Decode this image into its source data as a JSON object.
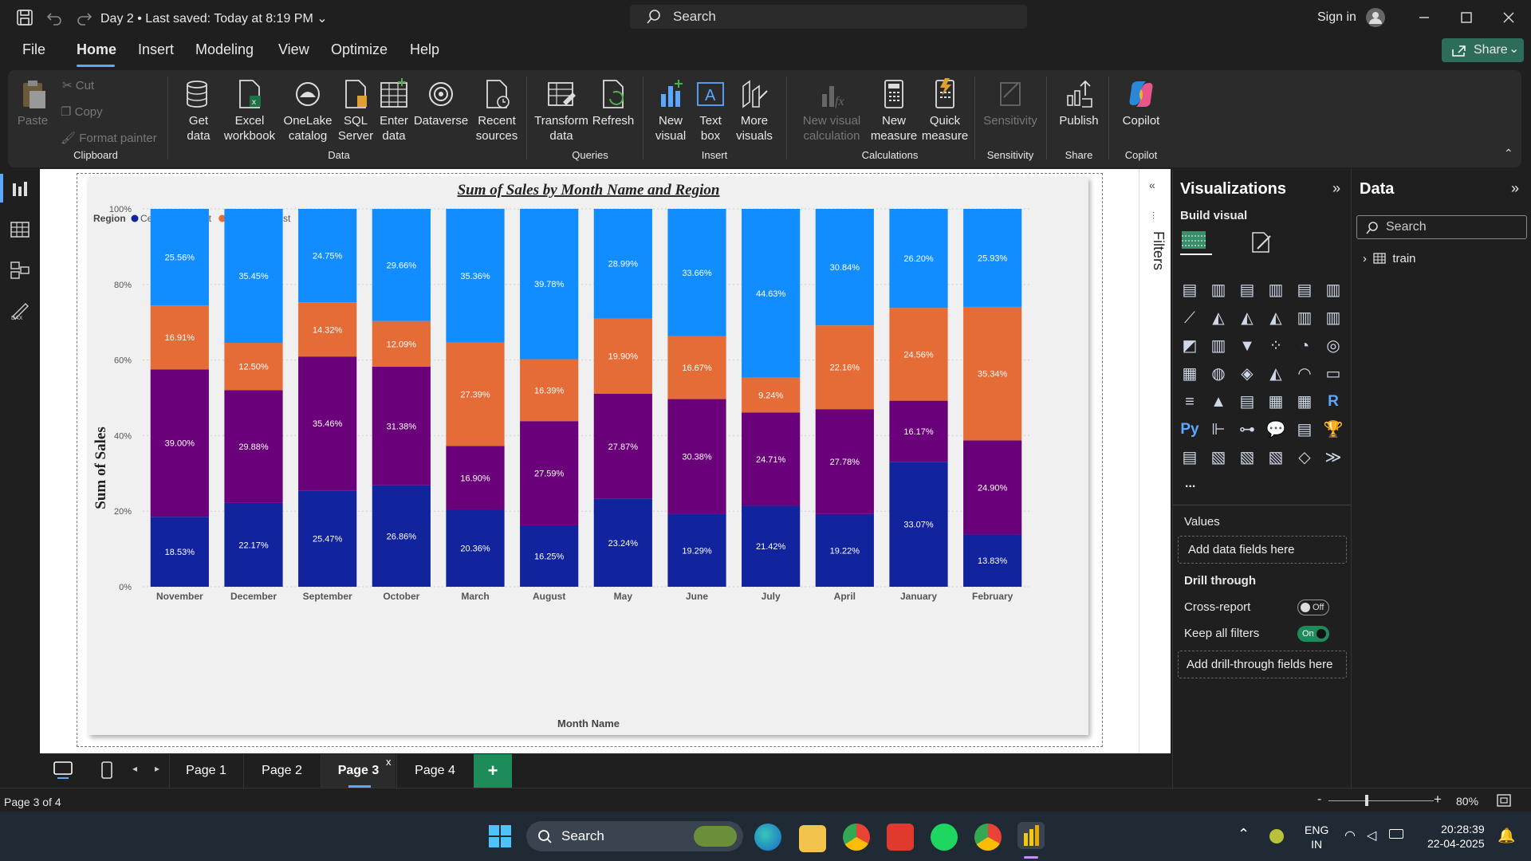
{
  "app": {
    "file_name": "Day 2",
    "saved": "Last saved: Today at 8:19 PM",
    "search": "Search",
    "signin": "Sign in"
  },
  "menus": [
    "File",
    "Home",
    "Insert",
    "Modeling",
    "View",
    "Optimize",
    "Help"
  ],
  "share": "Share",
  "ribbon": {
    "paste": "Paste",
    "cut": "Cut",
    "copy": "Copy",
    "format_painter": "Format painter",
    "clipboard": "Clipboard",
    "get_data": "Get data",
    "excel": "Excel workbook",
    "onelake": "OneLake catalog",
    "sql": "SQL Server",
    "enter": "Enter data",
    "dataverse": "Dataverse",
    "recent": "Recent sources",
    "data": "Data",
    "transform": "Transform data",
    "refresh": "Refresh",
    "queries": "Queries",
    "new_visual": "New visual",
    "text_box": "Text box",
    "more_visuals": "More visuals",
    "insert": "Insert",
    "new_visual_calc": "New visual calculation",
    "new_measure": "New measure",
    "quick_measure": "Quick measure",
    "calculations": "Calculations",
    "sensitivity": "Sensitivity",
    "sensitivity_group": "Sensitivity",
    "publish": "Publish",
    "share_group": "Share",
    "copilot": "Copilot",
    "copilot_group": "Copilot"
  },
  "pages": [
    "Page 1",
    "Page 2",
    "Page 3",
    "Page 4"
  ],
  "active_page": "Page 3",
  "status": {
    "page": "Page 3 of 4",
    "zoom": "80%"
  },
  "filters": "Filters",
  "viz": {
    "title": "Visualizations",
    "build": "Build visual",
    "values": "Values",
    "add_fields": "Add data fields here",
    "drill": "Drill through",
    "cross": "Cross-report",
    "keep": "Keep all filters",
    "off": "Off",
    "on": "On",
    "add_drill": "Add drill-through fields here",
    "more": "..."
  },
  "data_pane": {
    "title": "Data",
    "search": "Search",
    "table": "train"
  },
  "taskbar": {
    "search": "Search",
    "lang": "ENG",
    "region": "IN",
    "time": "20:28:39",
    "date": "22-04-2025"
  },
  "colors": {
    "Central": "#12239e",
    "East": "#6b007b",
    "South": "#e66c37",
    "West": "#118dff"
  },
  "chart_data": {
    "type": "bar",
    "title": "Sum of Sales by Month Name and Region",
    "xlabel": "Month Name",
    "ylabel": "Sum of Sales",
    "legend_title": "Region",
    "legend_position": "top-left",
    "ylim": [
      0,
      100
    ],
    "y_ticks": [
      "0%",
      "20%",
      "40%",
      "60%",
      "80%",
      "100%"
    ],
    "stacked": "100%",
    "categories": [
      "November",
      "December",
      "September",
      "October",
      "March",
      "August",
      "May",
      "June",
      "July",
      "April",
      "January",
      "February"
    ],
    "series": [
      {
        "name": "Central",
        "values": [
          18.53,
          22.17,
          25.47,
          26.86,
          20.36,
          16.25,
          23.24,
          19.29,
          21.42,
          19.22,
          33.07,
          13.83
        ],
        "labels": [
          "18.53%",
          "22.17%",
          "25.47%",
          "26.86%",
          "20.36%",
          "16.25%",
          "23.24%",
          "19.29%",
          "21.42%",
          "19.22%",
          "33.07%",
          "13.83%"
        ]
      },
      {
        "name": "East",
        "values": [
          39.0,
          29.88,
          35.46,
          31.38,
          16.9,
          27.59,
          27.87,
          30.38,
          24.71,
          27.78,
          16.17,
          24.9
        ],
        "labels": [
          "39.00%",
          "29.88%",
          "35.46%",
          "31.38%",
          "16.90%",
          "27.59%",
          "27.87%",
          "30.38%",
          "24.71%",
          "27.78%",
          "16.17%",
          "24.90%"
        ]
      },
      {
        "name": "South",
        "values": [
          16.91,
          12.5,
          14.32,
          12.09,
          27.39,
          16.39,
          19.9,
          16.67,
          9.24,
          22.16,
          24.56,
          35.34
        ],
        "labels": [
          "16.91%",
          "12.50%",
          "14.32%",
          "12.09%",
          "27.39%",
          "16.39%",
          "19.90%",
          "16.67%",
          "9.24%",
          "22.16%",
          "24.56%",
          "35.34%"
        ]
      },
      {
        "name": "West",
        "values": [
          25.56,
          35.45,
          24.75,
          29.66,
          35.36,
          39.78,
          28.99,
          33.66,
          44.63,
          30.84,
          26.2,
          25.93
        ],
        "labels": [
          "25.56%",
          "35.45%",
          "24.75%",
          "29.66%",
          "35.36%",
          "39.78%",
          "28.99%",
          "33.66%",
          "44.63%",
          "30.84%",
          "26.20%",
          "25.93%"
        ]
      }
    ]
  }
}
